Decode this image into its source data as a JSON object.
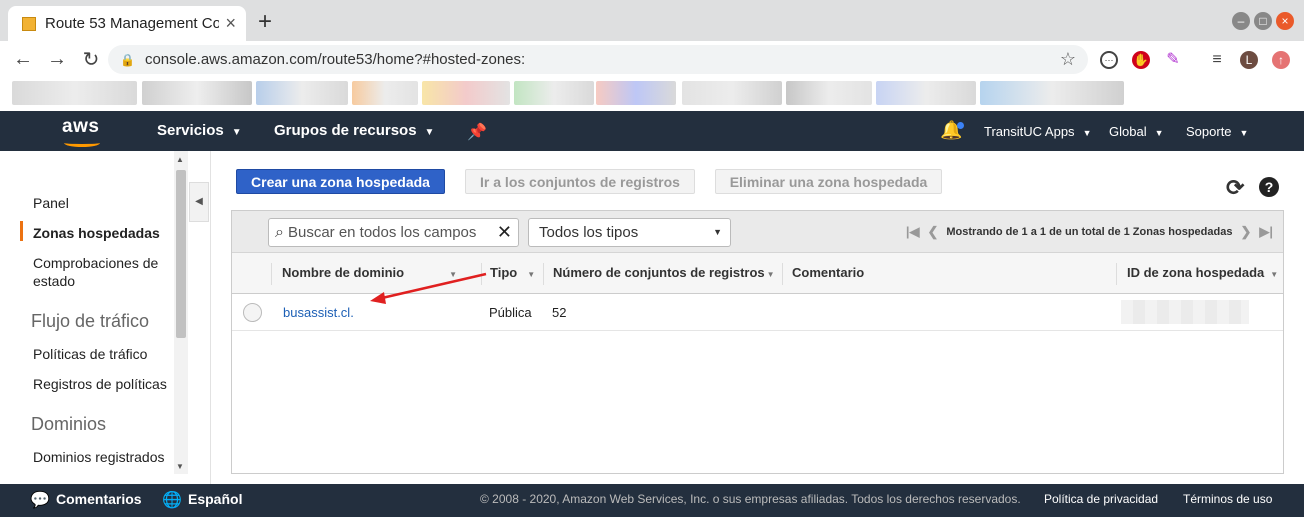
{
  "browser": {
    "tab_title": "Route 53 Management Co",
    "url": "console.aws.amazon.com/route53/home?#hosted-zones:",
    "profile_initial": "L"
  },
  "aws_nav": {
    "logo": "aws",
    "services": "Servicios",
    "resource_groups": "Grupos de recursos",
    "account": "TransitUC Apps",
    "region": "Global",
    "support": "Soporte"
  },
  "sidebar": {
    "items": [
      {
        "label": "Panel"
      },
      {
        "label": "Zonas hospedadas",
        "active": true
      },
      {
        "label": "Comprobaciones de estado"
      }
    ],
    "traffic_section": "Flujo de tráfico",
    "traffic_items": [
      "Políticas de tráfico",
      "Registros de políticas"
    ],
    "domains_section": "Dominios",
    "domains_items": [
      "Dominios registrados"
    ]
  },
  "actions": {
    "create": "Crear una zona hospedada",
    "goto_records": "Ir a los conjuntos de registros",
    "delete": "Eliminar una zona hospedada"
  },
  "filter": {
    "search_placeholder": "Buscar en todos los campos",
    "type_select": "Todos los tipos",
    "pager_text": "Mostrando de 1 a 1 de un total de 1 Zonas hospedadas"
  },
  "table": {
    "columns": [
      "Nombre de dominio",
      "Tipo",
      "Número de conjuntos de registros",
      "Comentario",
      "ID de zona hospedada"
    ],
    "rows": [
      {
        "domain": "busassist.cl.",
        "type": "Pública",
        "record_sets": "52",
        "comment": "",
        "zone_id": ""
      }
    ]
  },
  "footer": {
    "feedback": "Comentarios",
    "language": "Español",
    "copyright": "© 2008 - 2020, Amazon Web Services, Inc. o sus empresas afiliadas. Todos los derechos reservados.",
    "privacy": "Política de privacidad",
    "terms": "Términos de uso"
  },
  "colors": {
    "aws_navy": "#232f3e",
    "primary_button": "#2f62c8",
    "active_indicator": "#ec7211",
    "annotation_arrow": "#e02020"
  }
}
